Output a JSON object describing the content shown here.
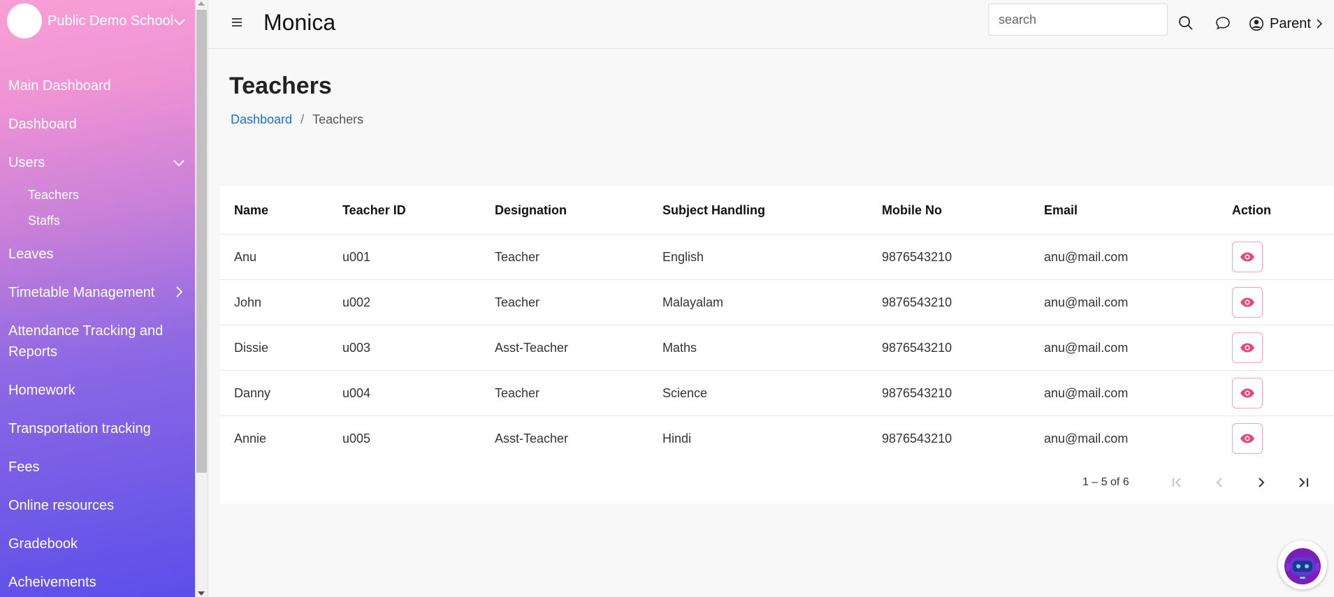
{
  "sidebar": {
    "school_name": "Public Demo School",
    "items": [
      {
        "label": "Main Dashboard"
      },
      {
        "label": "Dashboard"
      },
      {
        "label": "Users"
      },
      {
        "label": "Leaves"
      },
      {
        "label": "Timetable Management"
      },
      {
        "label": "Attendance Tracking and"
      },
      {
        "label": "Reports"
      },
      {
        "label": "Homework"
      },
      {
        "label": "Transportation tracking"
      },
      {
        "label": "Fees"
      },
      {
        "label": "Online resources"
      },
      {
        "label": "Gradebook"
      },
      {
        "label": "Acheivements"
      }
    ],
    "users_sub": [
      {
        "label": "Teachers"
      },
      {
        "label": "Staffs"
      }
    ]
  },
  "header": {
    "app_title": "Monica",
    "search_placeholder": "search",
    "user_label": "Parent"
  },
  "page": {
    "title": "Teachers",
    "breadcrumb": {
      "home": "Dashboard",
      "separator": "/",
      "current": "Teachers"
    }
  },
  "table": {
    "columns": [
      "Name",
      "Teacher ID",
      "Designation",
      "Subject Handling",
      "Mobile No",
      "Email",
      "Action"
    ],
    "rows": [
      {
        "name": "Anu",
        "id": "u001",
        "designation": "Teacher",
        "subject": "English",
        "mobile": "9876543210",
        "email": "anu@mail.com"
      },
      {
        "name": "John",
        "id": "u002",
        "designation": "Teacher",
        "subject": "Malayalam",
        "mobile": "9876543210",
        "email": "anu@mail.com"
      },
      {
        "name": "Dissie",
        "id": "u003",
        "designation": "Asst-Teacher",
        "subject": "Maths",
        "mobile": "9876543210",
        "email": "anu@mail.com"
      },
      {
        "name": "Danny",
        "id": "u004",
        "designation": "Teacher",
        "subject": "Science",
        "mobile": "9876543210",
        "email": "anu@mail.com"
      },
      {
        "name": "Annie",
        "id": "u005",
        "designation": "Asst-Teacher",
        "subject": "Hindi",
        "mobile": "9876543210",
        "email": "anu@mail.com"
      }
    ],
    "pagination_text": "1 – 5 of 6"
  },
  "colors": {
    "accent_pink": "#e8467f",
    "link_blue": "#1a6fe0",
    "sidebar_top": "#f79fd6",
    "sidebar_bottom": "#5b4fea"
  },
  "icons": {
    "menu": "hamburger-icon",
    "search": "search-icon",
    "chat": "chat-bubble-icon",
    "user": "user-circle-icon",
    "view": "eye-icon",
    "bot": "chatbot-icon"
  }
}
